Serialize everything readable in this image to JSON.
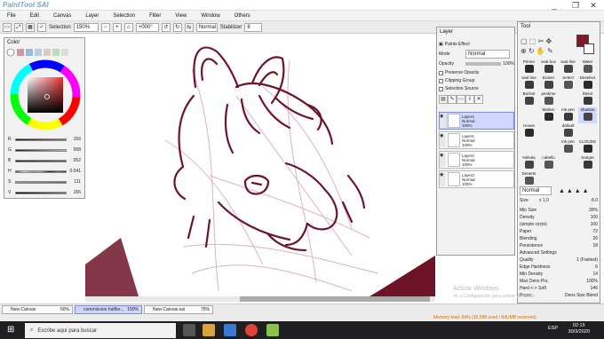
{
  "app": {
    "name": "PaintTool SAI",
    "window_controls": [
      "_",
      "❐",
      "✕"
    ]
  },
  "menu": [
    "File",
    "Edit",
    "Canvas",
    "Layer",
    "Selection",
    "Filter",
    "View",
    "Window",
    "Others"
  ],
  "toolbar": {
    "selection_label": "Selection",
    "zoom": "150%",
    "rotation": "+000°",
    "blend_mode": "Normal",
    "stabilizer_label": "Stabilizer",
    "stabilizer_value": "8"
  },
  "color_panel": {
    "title": "Color",
    "sliders": [
      {
        "label": "R",
        "value": "156",
        "fraction": 0.61,
        "color": "#b33"
      },
      {
        "label": "G",
        "value": "068",
        "fraction": 0.27,
        "color": "#3a3"
      },
      {
        "label": "B",
        "value": "052",
        "fraction": 0.2,
        "color": "#33b"
      },
      {
        "label": "H",
        "value": "0.041",
        "fraction": 0.04,
        "color": "#c3c"
      },
      {
        "label": "S",
        "value": "111",
        "fraction": 0.44,
        "color": "#a44"
      },
      {
        "label": "V",
        "value": "156",
        "fraction": 0.61,
        "color": "#555"
      }
    ]
  },
  "layer_panel": {
    "title": "Layer",
    "paint_effect": "Paints Effect",
    "mode_label": "Mode",
    "mode_value": "Normal",
    "opacity_label": "Opacity",
    "opacity_value": "100%",
    "checks": [
      "Preserve Opacity",
      "Clipping Group",
      "Selection Source"
    ],
    "layers": [
      {
        "name": "Layer4",
        "mode": "Normal",
        "opacity": "100%",
        "selected": true
      },
      {
        "name": "Layer1",
        "mode": "Normal",
        "opacity": "100%",
        "selected": false
      },
      {
        "name": "Layer2",
        "mode": "Normal",
        "opacity": "100%",
        "selected": false
      },
      {
        "name": "Layer3",
        "mode": "Normal",
        "opacity": "100%",
        "selected": false
      }
    ]
  },
  "tool_panel": {
    "title": "Tool",
    "tools": [
      [
        "Primer",
        "seal box",
        "seal line",
        "Water"
      ],
      [
        "seal line",
        "Eraser",
        "Select",
        "Deselect"
      ],
      [
        "Bucket",
        "pentime",
        "",
        "blend"
      ],
      [
        "",
        "Marker",
        "mk pen",
        "shadow"
      ],
      [
        "Hosas",
        "",
        "dafault",
        ""
      ],
      [
        "",
        "",
        "Ink pen",
        "CLOUDS"
      ],
      [
        "Nebula",
        "cabello",
        "",
        "Sangre"
      ],
      [
        "Deserts",
        "",
        "",
        ""
      ]
    ],
    "blend_mode": "Normal",
    "size_label": "Size",
    "size_mult": "x 1.0",
    "size_value": "8.0",
    "props": [
      {
        "label": "Min Size",
        "value": "30%"
      },
      {
        "label": "Density",
        "value": "100"
      },
      {
        "label": "(simple circle)",
        "value": "100"
      },
      {
        "label": "Paper",
        "value": "72"
      },
      {
        "label": "Blending",
        "value": "26"
      },
      {
        "label": "Persistence",
        "value": "18"
      },
      {
        "label": "Advanced Settings",
        "value": ""
      },
      {
        "label": "Quality",
        "value": "1 (Fastest)"
      },
      {
        "label": "Edge Hardness",
        "value": "6"
      },
      {
        "label": "Min Density",
        "value": "14"
      },
      {
        "label": "Max Dens Prs.",
        "value": "100%"
      },
      {
        "label": "Hard <-> Soft",
        "value": "146"
      },
      {
        "label": "Press:",
        "value": "Dens  Size  Blend"
      }
    ]
  },
  "tabs": [
    {
      "name": "New Canvas",
      "zoom": "50%",
      "active": false
    },
    {
      "name": "commission halfbo...",
      "zoom": "150%",
      "active": true
    },
    {
      "name": "New Canvas.sai",
      "zoom": "75%",
      "active": false
    }
  ],
  "status": {
    "memory": "Memory load: 84% (15,598 used / 84UMB reserved)",
    "watermark_line1": "Activar Windows",
    "watermark_line2": "Ve a Configuración para activar Windows."
  },
  "taskbar": {
    "search_placeholder": "Escribe aquí para buscar",
    "language": "ESP",
    "time": "02:15",
    "date": "30/3/2020"
  },
  "colors": {
    "accent": "#7d1a2c",
    "line_art": "#6e1428",
    "sketch": "#d8aab8"
  }
}
